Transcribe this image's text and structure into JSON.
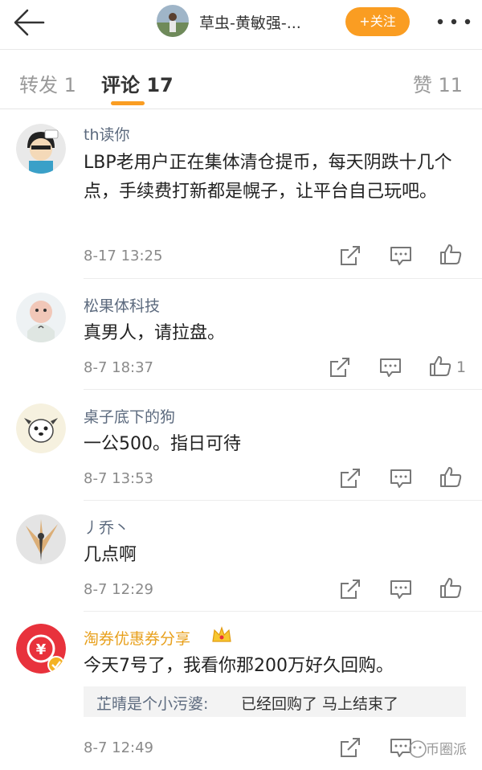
{
  "header": {
    "title": "草虫-黄敏强-...",
    "follow_label": "+关注"
  },
  "tabs": [
    {
      "label": "转发 1"
    },
    {
      "label": "评论 17"
    },
    {
      "label": "赞 11"
    }
  ],
  "comments": [
    {
      "user": "th读你",
      "text": "LBP老用户正在集体清仓提币，每天阴跌十几个点，手续费打新都是幌子，让平台自己玩吧。",
      "time": "8-17 13:25",
      "likes": ""
    },
    {
      "user": "松果体科技",
      "text": "真男人，请拉盘。",
      "time": "8-7 18:37",
      "likes": "1"
    },
    {
      "user": "桌子底下的狗",
      "text": "一公500。指日可待",
      "time": "8-7 13:53",
      "likes": ""
    },
    {
      "user": "丿乔丶",
      "text": "几点啊",
      "time": "8-7 12:29",
      "likes": ""
    },
    {
      "user": "淘券优惠券分享",
      "text": "今天7号了，我看你那200万好久回购。",
      "time": "8-7 12:49",
      "likes": ""
    }
  ],
  "reply": {
    "user": "芷晴是个小污婆:",
    "text": "已经回购了 马上结束了"
  },
  "watermark": "币圈派",
  "colors": {
    "accent": "#fa9d22",
    "username": "#5c6a7e",
    "vip_username": "#e8a01c"
  }
}
